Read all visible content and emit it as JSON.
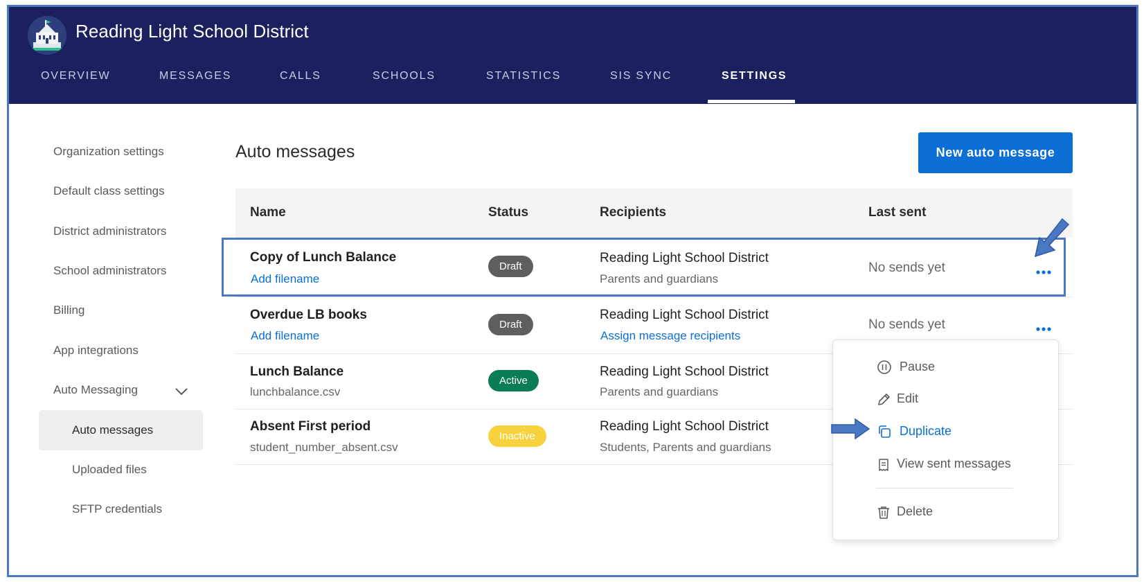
{
  "app": {
    "title": "Reading Light School District"
  },
  "nav": {
    "items": [
      {
        "label": "OVERVIEW"
      },
      {
        "label": "MESSAGES"
      },
      {
        "label": "CALLS"
      },
      {
        "label": "SCHOOLS"
      },
      {
        "label": "STATISTICS"
      },
      {
        "label": "SIS SYNC"
      },
      {
        "label": "SETTINGS",
        "active": true
      }
    ]
  },
  "sidebar": {
    "items": [
      {
        "label": "Organization settings"
      },
      {
        "label": "Default class settings"
      },
      {
        "label": "District administrators"
      },
      {
        "label": "School administrators"
      },
      {
        "label": "Billing"
      },
      {
        "label": "App integrations"
      },
      {
        "label": "Auto Messaging",
        "expanded": true,
        "icon": "chevron-down-icon"
      }
    ],
    "subitems": [
      {
        "label": "Auto messages",
        "selected": true
      },
      {
        "label": "Uploaded files"
      },
      {
        "label": "SFTP credentials"
      }
    ]
  },
  "main": {
    "title": "Auto messages",
    "new_button_label": "New auto message",
    "table": {
      "headers": [
        "Name",
        "Status",
        "Recipients",
        "Last sent"
      ],
      "rows": [
        {
          "name": "Copy of Lunch Balance",
          "file": "Add filename",
          "file_is_link": true,
          "status": "Draft",
          "recipient": "Reading Light School District",
          "recipient_sub": "Parents and guardians",
          "last_sent": "No sends yet",
          "highlighted": true
        },
        {
          "name": "Overdue LB books",
          "file": "Add filename",
          "file_is_link": true,
          "status": "Draft",
          "recipient": "Reading Light School District",
          "recipient_sub": "Assign message recipients",
          "recipient_sub_is_link": true,
          "last_sent": "No sends yet"
        },
        {
          "name": "Lunch Balance",
          "file": "lunchbalance.csv",
          "status": "Active",
          "recipient": "Reading Light School District",
          "recipient_sub": "Parents and guardians"
        },
        {
          "name": "Absent First period",
          "file": "student_number_absent.csv",
          "status": "Inactive",
          "recipient": "Reading Light School District",
          "recipient_sub": "Students, Parents and guardians"
        }
      ]
    }
  },
  "menu": {
    "items": [
      {
        "label": "Pause",
        "icon": "pause-icon"
      },
      {
        "label": "Edit",
        "icon": "pencil-icon"
      },
      {
        "label": "Duplicate",
        "icon": "duplicate-icon",
        "highlighted": true
      },
      {
        "label": "View sent messages",
        "icon": "receipt-icon"
      },
      {
        "label": "Delete",
        "icon": "trash-icon"
      }
    ]
  },
  "colors": {
    "header_bg": "#1b215f",
    "accent": "#0b6fd6",
    "annotation": "#4a78c2",
    "draft": "#5e5e5e",
    "active": "#0a7d55",
    "inactive": "#f7d23c"
  }
}
